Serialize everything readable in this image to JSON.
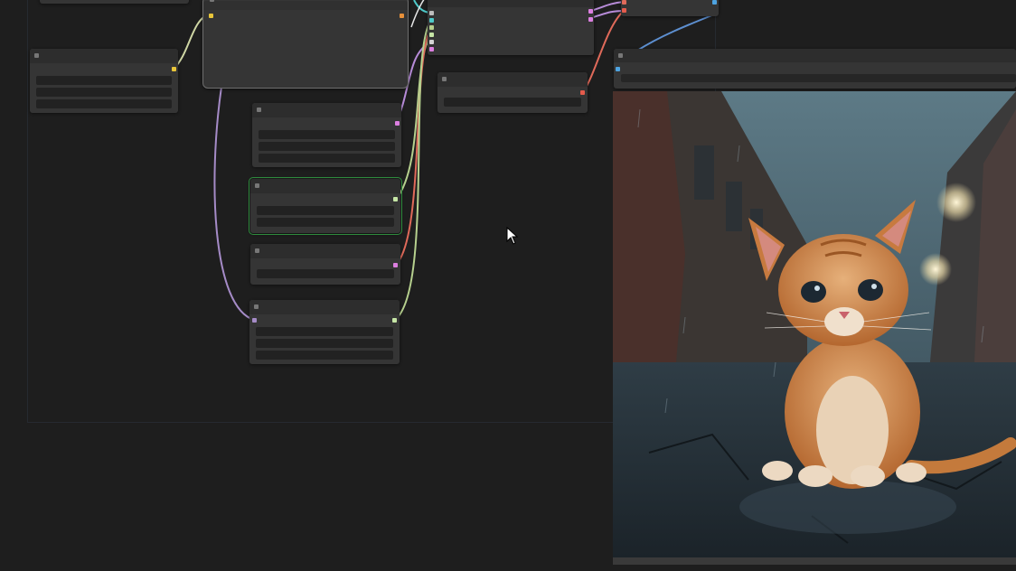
{
  "app": {
    "name": ""
  },
  "colors": {
    "background": "#1e1e1e",
    "node_body": "#353535",
    "node_header": "#2d2d2d",
    "widget": "#222222",
    "selected_outline": "#2e8b3d",
    "link_purple": "#a58bc7",
    "link_green": "#b6d08e",
    "link_red": "#e06a5a",
    "link_blue": "#5d8fd0",
    "link_cyan": "#4ec9c9",
    "port_yellow": "#e8c53a",
    "port_orange": "#e7903a",
    "port_pink": "#dc7fe0",
    "port_red": "#e45b4c",
    "port_blue": "#4ea3e0",
    "port_lightgreen": "#c6e6a6"
  },
  "nodes": [
    {
      "id": "checkpoint-loader",
      "title": ""
    },
    {
      "id": "sampler",
      "title": ""
    },
    {
      "id": "positive-prompt",
      "title": ""
    },
    {
      "id": "negative-prompt",
      "title": ""
    },
    {
      "id": "empty-latent",
      "title": ""
    },
    {
      "id": "lora-loader",
      "title": ""
    },
    {
      "id": "vae-decode",
      "title": ""
    },
    {
      "id": "upscale",
      "title": ""
    },
    {
      "id": "save-image",
      "title": ""
    }
  ],
  "preview": {
    "subject": "kitten-on-wet-street",
    "icon": "image-preview"
  },
  "cursor": {
    "icon": "arrow-cursor-icon"
  }
}
